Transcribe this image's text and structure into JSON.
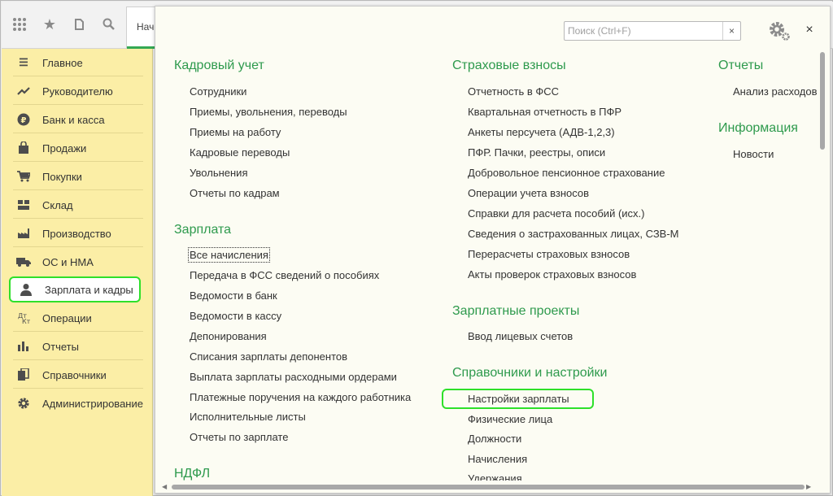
{
  "toolbar": {
    "icons": [
      "apps-grid-icon",
      "star-icon",
      "history-icon",
      "search-icon"
    ],
    "tab_label": "Нач"
  },
  "sidebar": {
    "items": [
      {
        "label": "Главное",
        "icon": "menu-icon"
      },
      {
        "label": "Руководителю",
        "icon": "trend-icon"
      },
      {
        "label": "Банк и касса",
        "icon": "ruble-icon"
      },
      {
        "label": "Продажи",
        "icon": "bag-icon"
      },
      {
        "label": "Покупки",
        "icon": "cart-icon"
      },
      {
        "label": "Склад",
        "icon": "box-icon"
      },
      {
        "label": "Производство",
        "icon": "factory-icon"
      },
      {
        "label": "ОС и НМА",
        "icon": "truck-icon"
      },
      {
        "label": "Зарплата и кадры",
        "icon": "person-icon"
      },
      {
        "label": "Операции",
        "icon": "operations-icon"
      },
      {
        "label": "Отчеты",
        "icon": "bar-chart-icon"
      },
      {
        "label": "Справочники",
        "icon": "books-icon"
      },
      {
        "label": "Администрирование",
        "icon": "gear-icon"
      }
    ],
    "active_index": 8,
    "highlight_color": "#2ee02a"
  },
  "search": {
    "placeholder": "Поиск (Ctrl+F)",
    "value": "",
    "clear_label": "×"
  },
  "close_label": "×",
  "columns": {
    "col1": {
      "sections": [
        {
          "title": "Кадровый учет",
          "links": [
            "Сотрудники",
            "Приемы, увольнения, переводы",
            "Приемы на работу",
            "Кадровые переводы",
            "Увольнения",
            "Отчеты по кадрам"
          ]
        },
        {
          "title": "Зарплата",
          "links": [
            "Все начисления",
            "Передача в ФСС сведений о пособиях",
            "Ведомости в банк",
            "Ведомости в кассу",
            "Депонирования",
            "Списания зарплаты депонентов",
            "Выплата зарплаты расходными ордерами",
            "Платежные поручения на каждого работника",
            "Исполнительные листы",
            "Отчеты по зарплате"
          ]
        },
        {
          "title": "НДФЛ",
          "links": []
        }
      ]
    },
    "col2": {
      "sections": [
        {
          "title": "Страховые взносы",
          "links": [
            "Отчетность в ФСС",
            "Квартальная отчетность в ПФР",
            "Анкеты персучета (АДВ-1,2,3)",
            "ПФР. Пачки, реестры, описи",
            "Добровольное пенсионное страхование",
            "Операции учета взносов",
            "Справки для расчета пособий (исх.)",
            "Сведения о застрахованных лицах, СЗВ-М",
            "Перерасчеты страховых взносов",
            "Акты проверок страховых взносов"
          ]
        },
        {
          "title": "Зарплатные проекты",
          "links": [
            "Ввод лицевых счетов"
          ]
        },
        {
          "title": "Справочники и настройки",
          "links": [
            "Настройки зарплаты",
            "Физические лица",
            "Должности",
            "Начисления",
            "Удержания"
          ]
        }
      ]
    },
    "col3": {
      "sections": [
        {
          "title": "Отчеты",
          "links": [
            "Анализ расходов"
          ]
        },
        {
          "title": "Информация",
          "links": [
            "Новости"
          ]
        }
      ]
    }
  },
  "colors": {
    "section_title": "#2e9a4d",
    "sidebar_bg": "#fbeea6",
    "panel_bg": "#fcfcf3",
    "highlight": "#2ee02a"
  }
}
